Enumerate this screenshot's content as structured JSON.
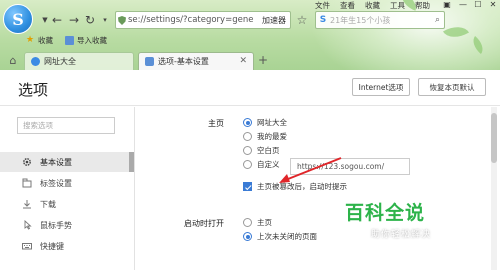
{
  "browser": {
    "address_url": "se://settings/?category=gene",
    "address_accelerator": "加速器",
    "search_placeholder": "21年生15个小孩",
    "menu": [
      "文件",
      "查看",
      "收藏",
      "工具",
      "帮助"
    ]
  },
  "bookmarks": [
    {
      "label": "收藏",
      "icon": "star-icon"
    },
    {
      "label": "导入收藏",
      "icon": "folder-icon"
    }
  ],
  "tabs": [
    {
      "label": "网址大全",
      "icon": "sogou-icon",
      "active": false
    },
    {
      "label": "选项-基本设置",
      "icon": "settings-page-icon",
      "active": true
    }
  ],
  "page": {
    "title": "选项",
    "internet_options": "Internet选项",
    "restore_default": "恢复本页默认"
  },
  "sidebar": {
    "search_placeholder": "搜索选项",
    "items": [
      {
        "label": "基本设置",
        "icon": "gear-icon",
        "active": true
      },
      {
        "label": "标签设置",
        "icon": "tab-icon",
        "active": false
      },
      {
        "label": "下载",
        "icon": "download-icon",
        "active": false
      },
      {
        "label": "鼠标手势",
        "icon": "mouse-icon",
        "active": false
      },
      {
        "label": "快捷键",
        "icon": "keyboard-icon",
        "active": false
      }
    ]
  },
  "homepage": {
    "label": "主页",
    "options": [
      {
        "label": "网址大全",
        "checked": true
      },
      {
        "label": "我的最爱",
        "checked": false
      },
      {
        "label": "空白页",
        "checked": false
      },
      {
        "label": "自定义",
        "checked": false
      }
    ],
    "custom_url": "https://123.sogou.com/",
    "tamper_notice": "主页被篡改后，启动时提示"
  },
  "startup": {
    "label": "启动时打开",
    "options": [
      {
        "label": "主页",
        "checked": false
      },
      {
        "label": "上次未关闭的页面",
        "checked": true
      }
    ]
  },
  "watermark": {
    "title": "百科全说",
    "subtitle": "助你轻松解决"
  },
  "colors": {
    "accent": "#3a7bd5",
    "arrow": "#e0262a",
    "watermark_green": "#2db34a"
  }
}
